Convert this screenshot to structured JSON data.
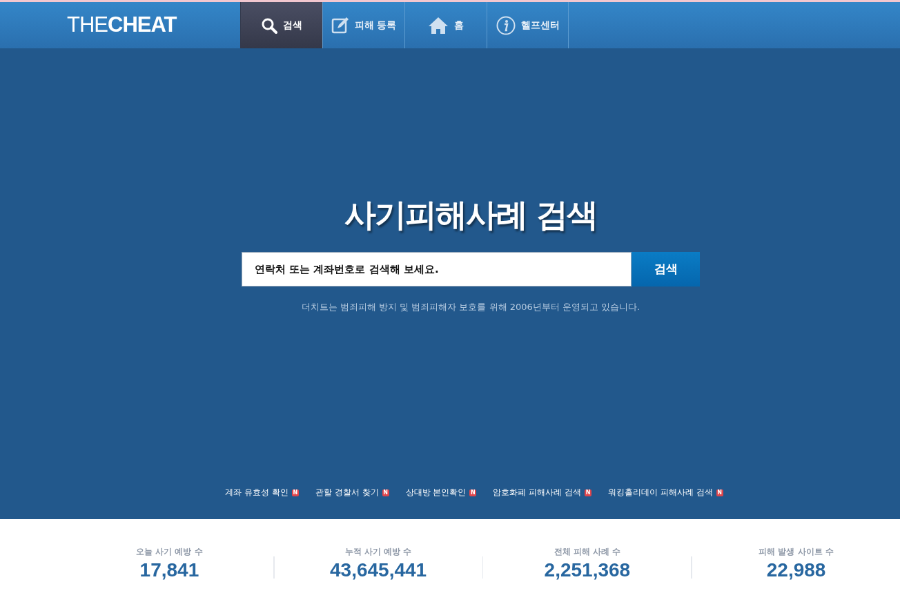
{
  "logo": "THE**CHEAT**",
  "nav": [
    {
      "label": "검색",
      "kind": "search",
      "selected": true
    },
    {
      "label": "피해 등록",
      "kind": "edit",
      "selected": false
    },
    {
      "label": "홈",
      "kind": "home",
      "selected": false
    },
    {
      "label": "헬프센터",
      "kind": "info",
      "selected": false
    }
  ],
  "hero": {
    "title": "사기피해사례 검색",
    "search": {
      "placeholder": "연락처 또는 계좌번호로 검색해 보세요.",
      "button": "검색"
    },
    "notice": "더치트는 범죄피해 방지 및 범죄피해자 보호를 위해 2006년부터 운영되고 있습니다."
  },
  "quick_links": [
    {
      "label": "계좌 유효성 확인",
      "badge": "N"
    },
    {
      "label": "관할 경찰서 찾기",
      "badge": "N"
    },
    {
      "label": "상대방 본인확인",
      "badge": "N"
    },
    {
      "label": "암호화폐 피해사례 검색",
      "badge": "N"
    },
    {
      "label": "워킹홀리데이 피해사례 검색",
      "badge": "N"
    }
  ],
  "stats": [
    {
      "label": "오늘 사기 예방 수",
      "value": "17,841"
    },
    {
      "label": "누적 사기 예방 수",
      "value": "43,645,441"
    },
    {
      "label": "전체 피해 사례 수",
      "value": "2,251,368"
    },
    {
      "label": "피해 발생 사이트 수",
      "value": "22,988"
    }
  ]
}
